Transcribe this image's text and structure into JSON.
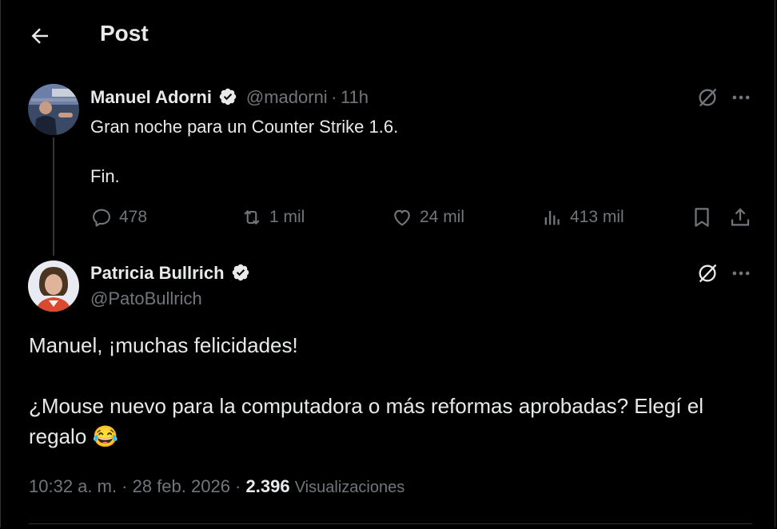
{
  "header": {
    "title": "Post",
    "back_icon": "arrow-left-icon"
  },
  "reply_to": {
    "name": "Manuel Adorni",
    "handle": "@madorni",
    "separator": "·",
    "time": "11h",
    "line1": "Gran noche para un Counter Strike 1.6.",
    "line2": "Fin.",
    "stats": {
      "replies": "478",
      "reposts": "1 mil",
      "likes": "24 mil",
      "views": "413 mil"
    }
  },
  "post": {
    "name": "Patricia Bullrich",
    "handle": "@PatoBullrich",
    "line1": "Manuel, ¡muchas felicidades!",
    "line2": "¿Mouse nuevo para la computadora o más reformas aprobadas? Elegí el",
    "line3": "regalo",
    "emoji": "😂",
    "timestamp": "10:32 a. m. · 28 feb. 2026 ·",
    "views_count": "2.396",
    "views_label": "Visualizaciones"
  },
  "colors": {
    "verified": "#1d9bf0",
    "muted": "#71767b",
    "text": "#e7e9ea",
    "border": "#2f3336"
  }
}
